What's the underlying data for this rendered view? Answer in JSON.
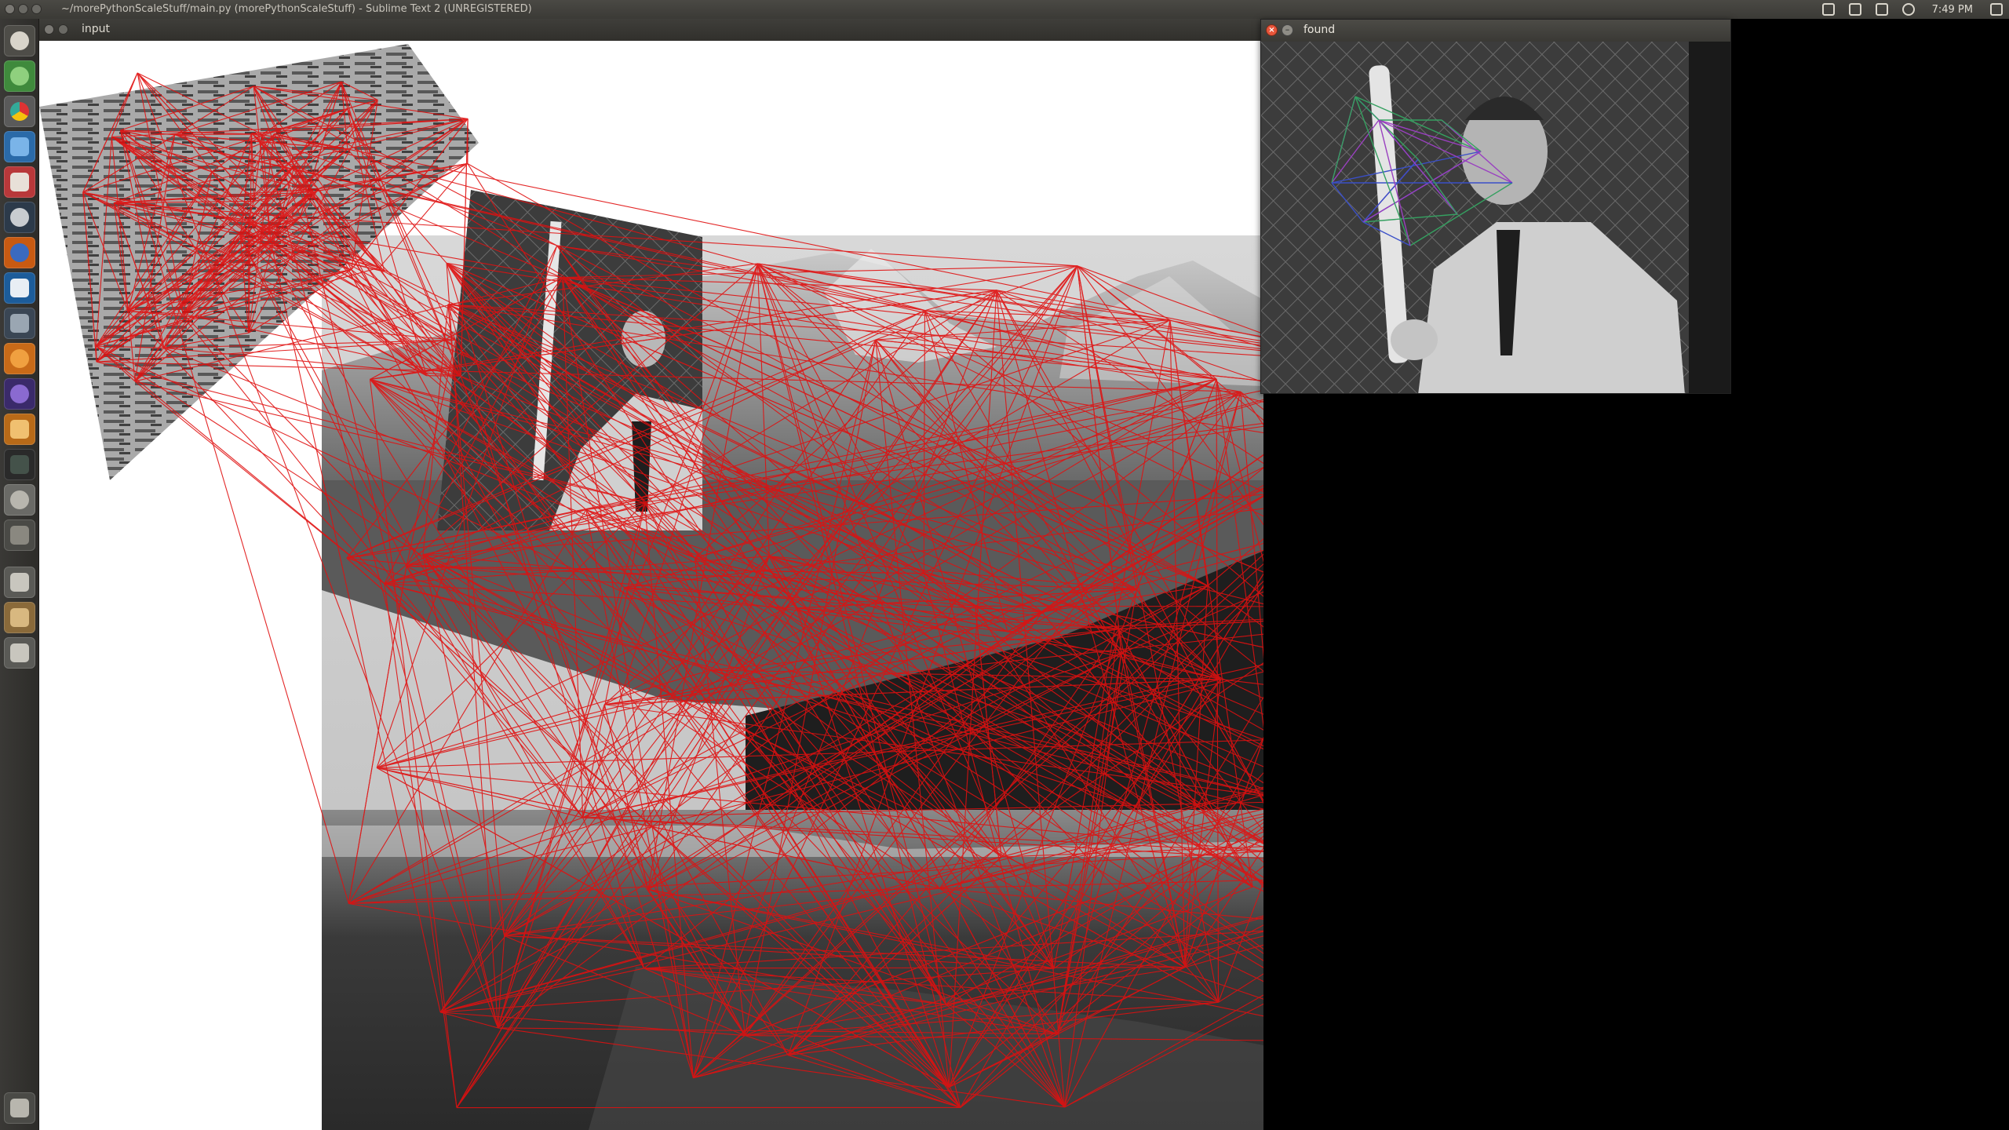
{
  "top_panel": {
    "window_title": "~/morePythonScaleStuff/main.py (morePythonScaleStuff) - Sublime Text 2 (UNREGISTERED)",
    "clock": "7:49 PM",
    "tray_icons": [
      "dropbox-icon",
      "messaging-icon",
      "keyboard-layout-icon",
      "volume-icon",
      "session-icon"
    ]
  },
  "launcher": {
    "items": [
      "dash-home-icon",
      "settings-icon",
      "chrome-icon",
      "libreoffice-icon",
      "calculator-icon",
      "steam-icon",
      "firefox-icon",
      "virtualbox-icon",
      "tools-icon",
      "ubuntu-one-icon",
      "eclipse-icon",
      "image-viewer-icon",
      "terminal-icon",
      "help-icon",
      "workspace-switcher-icon",
      "drive-icon",
      "files-icon",
      "drive-icon-2",
      "trash-icon"
    ]
  },
  "input_window": {
    "title": "input"
  },
  "found_window": {
    "title": "found"
  },
  "colors": {
    "match_lines": "#e01010",
    "found_lines": [
      "#3a4fc8",
      "#35a060",
      "#9a40c0"
    ],
    "panel": "#3b3a36"
  }
}
